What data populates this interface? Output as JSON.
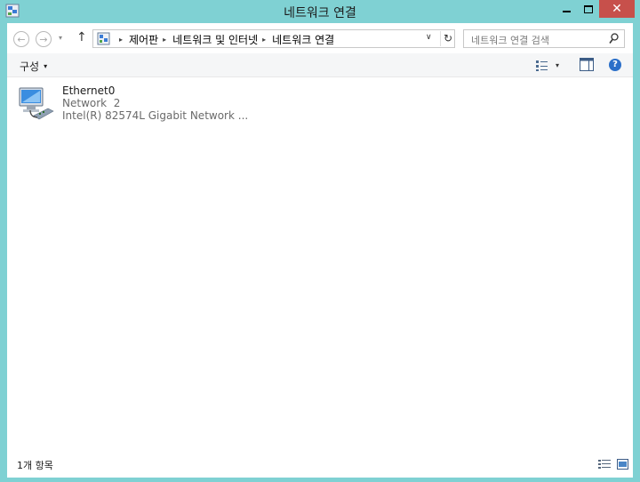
{
  "window": {
    "title": "네트워크 연결",
    "close_glyph": "✕",
    "colors": {
      "frame": "#7fd1d3",
      "close": "#c7504b",
      "help": "#2a6fc9"
    }
  },
  "nav": {
    "back_glyph": "←",
    "forward_glyph": "→",
    "recent_glyph": "▾",
    "up_glyph": "↑",
    "breadcrumbs": [
      {
        "label": "제어판"
      },
      {
        "label": "네트워크 및 인터넷"
      },
      {
        "label": "네트워크 연결"
      }
    ],
    "crumb_separator": "▸",
    "dropdown_glyph": "∨",
    "refresh_glyph": "↻",
    "search_placeholder": "네트워크 연결 검색"
  },
  "toolbar": {
    "organize_label": "구성",
    "caret": "▾",
    "help_glyph": "?"
  },
  "items": [
    {
      "name": "Ethernet0",
      "network": "Network  2",
      "device": "Intel(R) 82574L Gigabit Network ...",
      "icon": "network-adapter-icon"
    }
  ],
  "status": {
    "item_count": "1개 항목"
  }
}
